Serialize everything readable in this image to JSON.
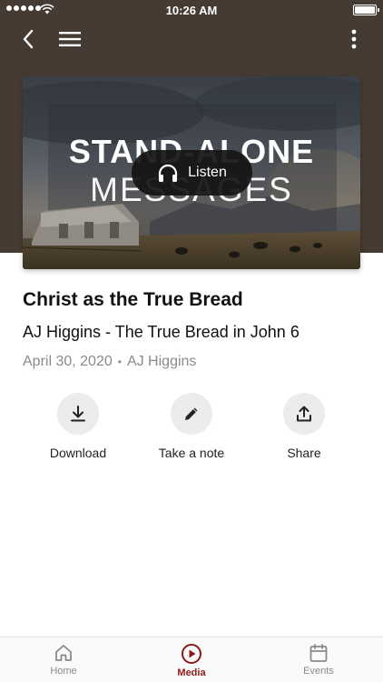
{
  "status_bar": {
    "time": "10:26 AM"
  },
  "header": {
    "back_icon": "chevron-left-icon",
    "menu_icon": "hamburger-menu-icon",
    "more_icon": "more-vertical-icon"
  },
  "artwork": {
    "line1": "STAND-ALONE",
    "line2": "MESSAGES",
    "listen_label": "Listen",
    "listen_icon": "headphones-icon"
  },
  "message": {
    "title": "Christ as the True Bread",
    "subtitle": "AJ Higgins - The True Bread in John 6",
    "date": "April 30, 2020",
    "separator": "•",
    "speaker": "AJ Higgins"
  },
  "actions": [
    {
      "label": "Download",
      "icon": "download-icon"
    },
    {
      "label": "Take a note",
      "icon": "pencil-icon"
    },
    {
      "label": "Share",
      "icon": "share-icon"
    }
  ],
  "tabs": [
    {
      "label": "Home",
      "icon": "home-icon"
    },
    {
      "label": "Media",
      "icon": "play-circle-icon",
      "active": true
    },
    {
      "label": "Events",
      "icon": "calendar-icon"
    }
  ],
  "colors": {
    "header_bg": "#453b32",
    "accent": "#8b1a1a",
    "muted_text": "#8a8a8a",
    "action_circle": "#ececec"
  }
}
